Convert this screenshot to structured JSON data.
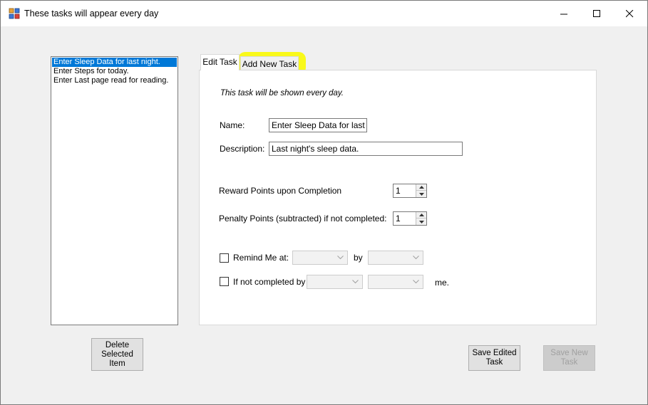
{
  "window": {
    "title": "These tasks will appear every day"
  },
  "task_list": {
    "items": [
      {
        "label": "Enter Sleep Data for last night.",
        "selected": true
      },
      {
        "label": "Enter Steps for today.",
        "selected": false
      },
      {
        "label": "Enter Last page read for reading.",
        "selected": false
      }
    ]
  },
  "buttons": {
    "delete": "Delete\nSelected\nItem",
    "save_edited": "Save Edited\nTask",
    "save_new": "Save New\nTask"
  },
  "tabs": {
    "edit": "Edit Task",
    "add": "Add New Task"
  },
  "form": {
    "note": "This task will be shown every day.",
    "name_label": "Name:",
    "name_value": "Enter Sleep Data for last nig",
    "description_label": "Description:",
    "description_value": "Last night's sleep data.",
    "reward_label": "Reward Points upon Completion",
    "reward_value": "1",
    "penalty_label": "Penalty Points (subtracted) if not completed:",
    "penalty_value": "1",
    "remind_label": "Remind Me at:",
    "by_label": "by",
    "not_completed_label": "If not completed by",
    "me_label": "me."
  },
  "colors": {
    "selection": "#0078d7",
    "highlight": "#f9f91a"
  }
}
